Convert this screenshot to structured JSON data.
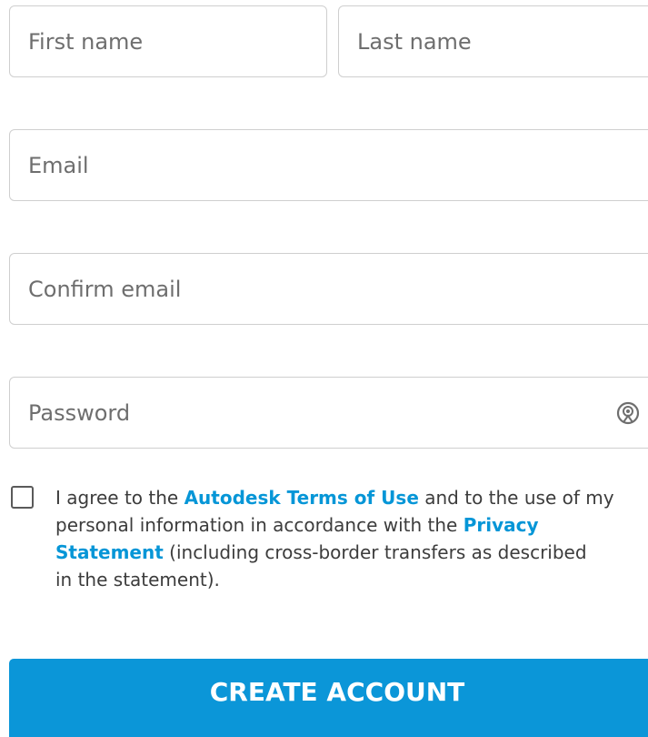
{
  "form": {
    "first_name": {
      "value": "",
      "placeholder": "First name"
    },
    "last_name": {
      "value": "",
      "placeholder": "Last name"
    },
    "email": {
      "value": "",
      "placeholder": "Email"
    },
    "confirm_email": {
      "value": "",
      "placeholder": "Confirm email"
    },
    "password": {
      "value": "",
      "placeholder": "Password",
      "toggle_icon": "eye-icon"
    }
  },
  "consent": {
    "checked": false,
    "line1_pre": "I agree to the ",
    "terms_link": "Autodesk Terms of Use",
    "line1_post": " and to the use of my",
    "line2_pre": "personal information in accordance with the ",
    "privacy_link_part1": "Privacy",
    "privacy_link_part2": "Statement",
    "line3_post": " (including cross-border transfers as described",
    "line4": "in the statement)."
  },
  "submit": {
    "label": "CREATE ACCOUNT"
  },
  "colors": {
    "accent": "#0696d7",
    "button": "#0b96d8",
    "border": "#cfcfcf",
    "text": "#3c3c3c"
  }
}
